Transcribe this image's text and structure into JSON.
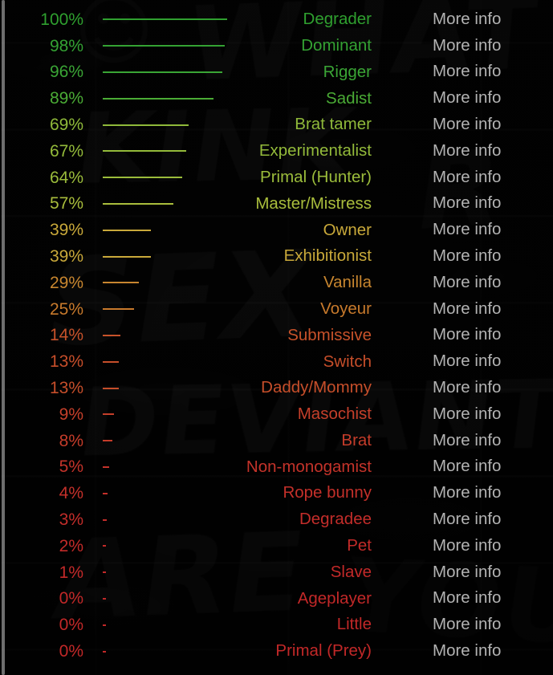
{
  "background": {
    "graffiti_words": {
      "what": "WHAT",
      "kink": "KINK",
      "sex": "SEX",
      "deviant": "DEVIANT",
      "are": "ARE",
      "you": "YOU",
      "tag_r": "R",
      "smile": "☺"
    }
  },
  "colors": {
    "page_background": "#050505",
    "more_info_text": "#b3b3b3",
    "scrollbar_thumb": "#bebebe",
    "top_green": "#3aa33a",
    "mid_yellow": "#c8a838",
    "low_red": "#c0392b"
  },
  "results": {
    "info_label": "More info",
    "rows": [
      {
        "percent": "100%",
        "value": 100,
        "name": "Degrader",
        "color": "#2fa02f",
        "info": "More info"
      },
      {
        "percent": "98%",
        "value": 98,
        "name": "Dominant",
        "color": "#34a233",
        "info": "More info"
      },
      {
        "percent": "96%",
        "value": 96,
        "name": "Rigger",
        "color": "#3aa535",
        "info": "More info"
      },
      {
        "percent": "89%",
        "value": 89,
        "name": "Sadist",
        "color": "#4aab35",
        "info": "More info"
      },
      {
        "percent": "69%",
        "value": 69,
        "name": "Brat tamer",
        "color": "#8fb93a",
        "info": "More info"
      },
      {
        "percent": "67%",
        "value": 67,
        "name": "Experimentalist",
        "color": "#93ba3a",
        "info": "More info"
      },
      {
        "percent": "64%",
        "value": 64,
        "name": "Primal (Hunter)",
        "color": "#9bbc3b",
        "info": "More info"
      },
      {
        "percent": "57%",
        "value": 57,
        "name": "Master/Mistress",
        "color": "#a9bd3c",
        "info": "More info"
      },
      {
        "percent": "39%",
        "value": 39,
        "name": "Owner",
        "color": "#c9a93a",
        "info": "More info"
      },
      {
        "percent": "39%",
        "value": 39,
        "name": "Exhibitionist",
        "color": "#c9a93a",
        "info": "More info"
      },
      {
        "percent": "29%",
        "value": 29,
        "name": "Vanilla",
        "color": "#c8862f",
        "info": "More info"
      },
      {
        "percent": "25%",
        "value": 25,
        "name": "Voyeur",
        "color": "#c87a2c",
        "info": "More info"
      },
      {
        "percent": "14%",
        "value": 14,
        "name": "Submissive",
        "color": "#c7522a",
        "info": "More info"
      },
      {
        "percent": "13%",
        "value": 13,
        "name": "Switch",
        "color": "#c64e2a",
        "info": "More info"
      },
      {
        "percent": "13%",
        "value": 13,
        "name": "Daddy/Mommy",
        "color": "#c64e2a",
        "info": "More info"
      },
      {
        "percent": "9%",
        "value": 9,
        "name": "Masochist",
        "color": "#c53f2a",
        "info": "More info"
      },
      {
        "percent": "8%",
        "value": 8,
        "name": "Brat",
        "color": "#c53c2a",
        "info": "More info"
      },
      {
        "percent": "5%",
        "value": 5,
        "name": "Non-monogamist",
        "color": "#c4332a",
        "info": "More info"
      },
      {
        "percent": "4%",
        "value": 4,
        "name": "Rope bunny",
        "color": "#c4302a",
        "info": "More info"
      },
      {
        "percent": "3%",
        "value": 3,
        "name": "Degradee",
        "color": "#c32d2a",
        "info": "More info"
      },
      {
        "percent": "2%",
        "value": 2,
        "name": "Pet",
        "color": "#c32b29",
        "info": "More info"
      },
      {
        "percent": "1%",
        "value": 1,
        "name": "Slave",
        "color": "#c32929",
        "info": "More info"
      },
      {
        "percent": "0%",
        "value": 0,
        "name": "Ageplayer",
        "color": "#c22828",
        "info": "More info"
      },
      {
        "percent": "0%",
        "value": 0,
        "name": "Little",
        "color": "#c22828",
        "info": "More info"
      },
      {
        "percent": "0%",
        "value": 0,
        "name": "Primal (Prey)",
        "color": "#c22828",
        "info": "More info"
      }
    ]
  },
  "chart_data": {
    "type": "bar",
    "title": "",
    "xlabel": "",
    "ylabel": "",
    "xlim": [
      0,
      100
    ],
    "grid": false,
    "legend": "none",
    "orientation": "horizontal",
    "categories": [
      "Degrader",
      "Dominant",
      "Rigger",
      "Sadist",
      "Brat tamer",
      "Experimentalist",
      "Primal (Hunter)",
      "Master/Mistress",
      "Owner",
      "Exhibitionist",
      "Vanilla",
      "Voyeur",
      "Submissive",
      "Switch",
      "Daddy/Mommy",
      "Masochist",
      "Brat",
      "Non-monogamist",
      "Rope bunny",
      "Degradee",
      "Pet",
      "Slave",
      "Ageplayer",
      "Little",
      "Primal (Prey)"
    ],
    "values": [
      100,
      98,
      96,
      89,
      69,
      67,
      64,
      57,
      39,
      39,
      29,
      25,
      14,
      13,
      13,
      9,
      8,
      5,
      4,
      3,
      2,
      1,
      0,
      0,
      0
    ],
    "units": "percent"
  }
}
